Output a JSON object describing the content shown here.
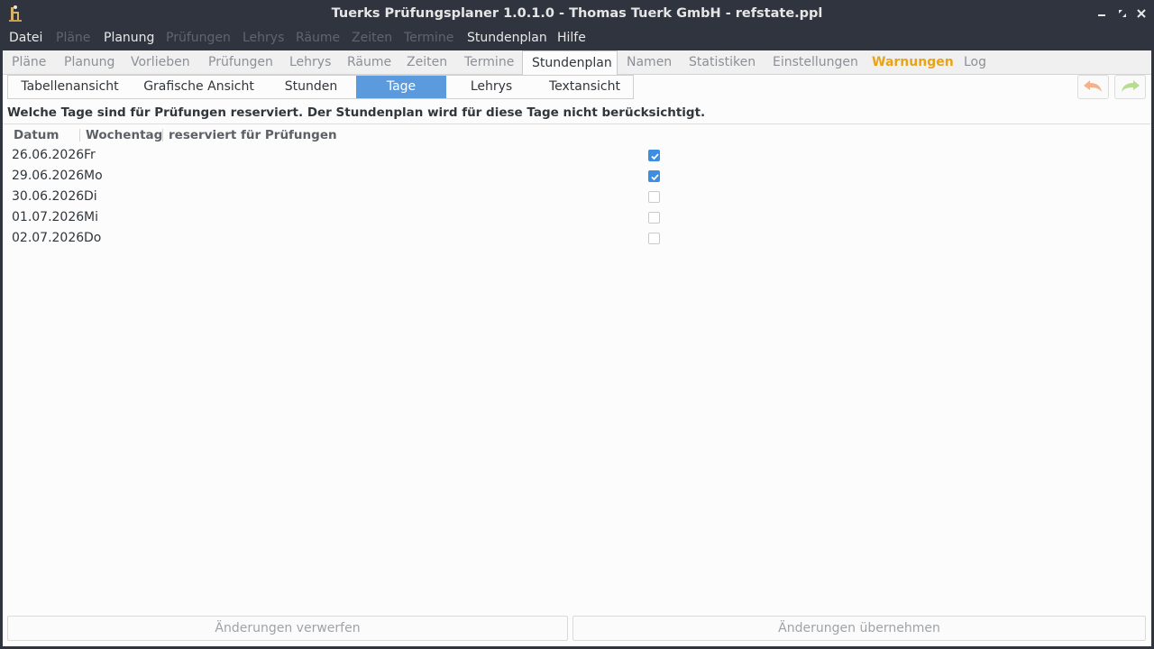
{
  "window": {
    "title": "Tuerks Prüfungsplaner 1.0.1.0 - Thomas Tuerk GmbH - refstate.ppl"
  },
  "menubar": [
    {
      "label": "Datei",
      "enabled": true
    },
    {
      "label": "Pläne",
      "enabled": false
    },
    {
      "label": "Planung",
      "enabled": true
    },
    {
      "label": "Prüfungen",
      "enabled": false
    },
    {
      "label": "Lehrys",
      "enabled": false
    },
    {
      "label": "Räume",
      "enabled": false
    },
    {
      "label": "Zeiten",
      "enabled": false
    },
    {
      "label": "Termine",
      "enabled": false
    },
    {
      "label": "Stundenplan",
      "enabled": true
    },
    {
      "label": "Hilfe",
      "enabled": true
    }
  ],
  "main_tabs": [
    {
      "label": "Pläne"
    },
    {
      "label": "Planung"
    },
    {
      "label": "Vorlieben"
    },
    {
      "label": "Prüfungen"
    },
    {
      "label": "Lehrys"
    },
    {
      "label": "Räume"
    },
    {
      "label": "Zeiten"
    },
    {
      "label": "Termine"
    },
    {
      "label": "Stundenplan",
      "active": true
    },
    {
      "label": "Namen"
    },
    {
      "label": "Statistiken"
    },
    {
      "label": "Einstellungen"
    },
    {
      "label": "Warnungen",
      "warning": true
    },
    {
      "label": "Log"
    }
  ],
  "sub_tabs": [
    {
      "label": "Tabellenansicht"
    },
    {
      "label": "Grafische Ansicht"
    },
    {
      "label": "Stunden"
    },
    {
      "label": "Tage",
      "active": true
    },
    {
      "label": "Lehrys"
    },
    {
      "label": "Textansicht"
    }
  ],
  "hint": "Welche Tage sind für Prüfungen reserviert. Der Stundenplan wird für diese Tage nicht berücksichtigt.",
  "table": {
    "columns": [
      "Datum",
      "Wochentag",
      "reserviert für Prüfungen"
    ],
    "rows": [
      {
        "date": "26.06.2026",
        "weekday": "Fr",
        "reserved": true
      },
      {
        "date": "29.06.2026",
        "weekday": "Mo",
        "reserved": true
      },
      {
        "date": "30.06.2026",
        "weekday": "Di",
        "reserved": false
      },
      {
        "date": "01.07.2026",
        "weekday": "Mi",
        "reserved": false
      },
      {
        "date": "02.07.2026",
        "weekday": "Do",
        "reserved": false
      }
    ]
  },
  "buttons": {
    "discard": "Änderungen verwerfen",
    "apply": "Änderungen übernehmen"
  },
  "icons": {
    "undo": "undo-arrow-icon",
    "redo": "redo-arrow-icon"
  },
  "colors": {
    "accent": "#5b9bdd",
    "warning": "#e8a317",
    "undo": "#f5b28a",
    "redo": "#b8db8f"
  }
}
